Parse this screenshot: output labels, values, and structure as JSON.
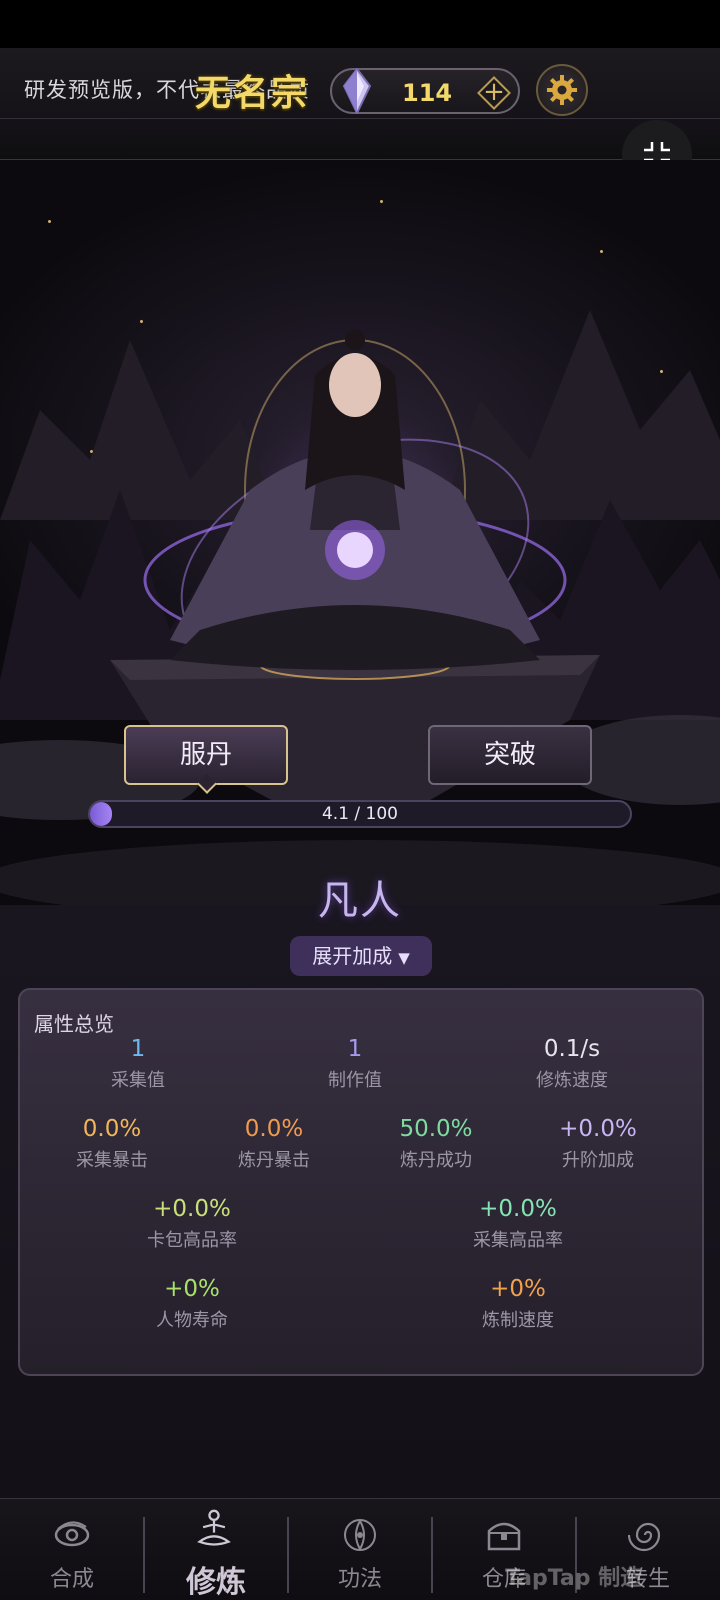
{
  "header": {
    "notice": "研发预览版，不代表最终品质",
    "sect_name": "无名宗",
    "currency_amount": "114",
    "add_label": "+"
  },
  "actions": {
    "take_pill": "服丹",
    "breakthrough": "突破"
  },
  "cultivation": {
    "progress_text": "4.1 / 100",
    "progress_fraction": 0.041,
    "realm": "凡人",
    "expand_label": "展开加成",
    "expand_arrow": "▼"
  },
  "panel": {
    "title": "属性总览",
    "stats": [
      {
        "value": "1",
        "name": "采集值",
        "color": "#6fb8ee"
      },
      {
        "value": "1",
        "name": "制作值",
        "color": "#a59bef"
      },
      {
        "value": "0.1/s",
        "name": "修炼速度",
        "color": "#e8e4ee"
      },
      {
        "value": "0.0%",
        "name": "采集暴击",
        "color": "#f0b65a"
      },
      {
        "value": "0.0%",
        "name": "炼丹暴击",
        "color": "#ef9a4f"
      },
      {
        "value": "50.0%",
        "name": "炼丹成功",
        "color": "#7fd9a1"
      },
      {
        "value": "+0.0%",
        "name": "升阶加成",
        "color": "#c8b6f3"
      },
      {
        "value": "+0.0%",
        "name": "卡包高品率",
        "color": "#c9e07a"
      },
      {
        "value": "+0.0%",
        "name": "采集高品率",
        "color": "#86e3b3"
      },
      {
        "value": "+0%",
        "name": "人物寿命",
        "color": "#a7e06c"
      },
      {
        "value": "+0%",
        "name": "炼制速度",
        "color": "#f2a14c"
      }
    ]
  },
  "nav": {
    "items": [
      {
        "label": "合成",
        "icon": "vortex-icon"
      },
      {
        "label": "修炼",
        "icon": "meditation-icon"
      },
      {
        "label": "功法",
        "icon": "technique-icon"
      },
      {
        "label": "仓库",
        "icon": "chest-icon"
      },
      {
        "label": "转生",
        "icon": "spiral-icon"
      }
    ],
    "active": "修炼"
  },
  "watermark": "TapTap 制造"
}
